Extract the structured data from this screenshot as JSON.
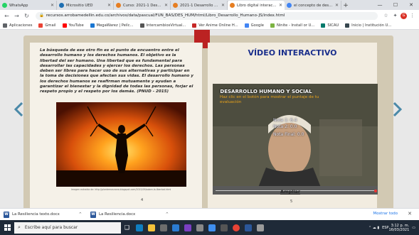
{
  "tabs": [
    {
      "label": "WhatsApp",
      "color": "#25d366",
      "active": false
    },
    {
      "label": "Micrositio UED",
      "color": "#1f6fb2",
      "active": false
    },
    {
      "label": "Curso: 2021-1 Desarrollo",
      "color": "#e67e22",
      "active": false
    },
    {
      "label": "2021-1 Desarrollo Hum",
      "color": "#e67e22",
      "active": false
    },
    {
      "label": "Libro digital interactivo",
      "color": "#e67e22",
      "active": true
    },
    {
      "label": "el concepto de desarrollo",
      "color": "#4285f4",
      "active": false
    }
  ],
  "browser": {
    "url": "recursos.arrobamedellin.edu.co/archivos/data/pascual/FUN_BAS/DES_HUM/html/Libro_Desarrollo_Humano-JS/index.html",
    "profile_initial": "G"
  },
  "bookmarks": [
    {
      "label": "Aplicaciones",
      "color": "#5f6368"
    },
    {
      "label": "Gmail",
      "color": "#ea4335"
    },
    {
      "label": "YouTube",
      "color": "#ff0000"
    },
    {
      "label": "MegaWarez | Pelíc...",
      "color": "#1976d2"
    },
    {
      "label": "IntercambiosVirtual...",
      "color": "#555555"
    },
    {
      "label": "Ver Anime Online H...",
      "color": "#c62828"
    },
    {
      "label": "Google",
      "color": "#4285f4"
    },
    {
      "label": "Ninite - Install or U...",
      "color": "#7cb342"
    },
    {
      "label": "SICAU",
      "color": "#00796b"
    },
    {
      "label": "Inicio | Institución U...",
      "color": "#37474f"
    }
  ],
  "left_page": {
    "text": "La búsqueda de ese otro fin es el punto de encuentro entre el desarrollo humano y los derechos humanos. El objetivo es la libertad del ser humano. Una libertad que es fundamental para desarrollar las capacidades y ejercer los derechos. Las personas deben ser libres para hacer uso de sus alternativas y participar en la toma de decisiones que afectan sus vidas. El desarrollo humano y los derechos humanos se reafirman mutuamente y ayudan a garantizar el bienestar y la dignidad de todas las personas, forjar el respeto propio y el respeto por los demás. (PNUD - 2015)",
    "caption": "Imagen extraída de: http://plantemosnana.blogspot.com/2015/09/sobre-la-libertad.html",
    "page_number": "4"
  },
  "right_page": {
    "title": "VÍDEO INTERACTIVO",
    "video_heading": "DESARROLLO HUMANO Y SOCIAL",
    "video_subtitle": "Haz clic en el botón para mostrar el puntaje de tu evaluación",
    "nota_1": "Nota 1: 6.4",
    "nota_2": "Nota 2: 0.0",
    "nota_final": "Nota Final: 0.0",
    "ampliar": "Ampliar",
    "page_number": "5"
  },
  "downloads": {
    "items": [
      {
        "label": "La Resiliencia texto.docx"
      },
      {
        "label": "La Resiliencia.docx"
      }
    ],
    "show_all": "Mostrar todo"
  },
  "taskbar": {
    "search_placeholder": "Escribe aquí para buscar",
    "language": "ESP",
    "time": "3:12 p. m.",
    "date": "16/03/2021"
  }
}
